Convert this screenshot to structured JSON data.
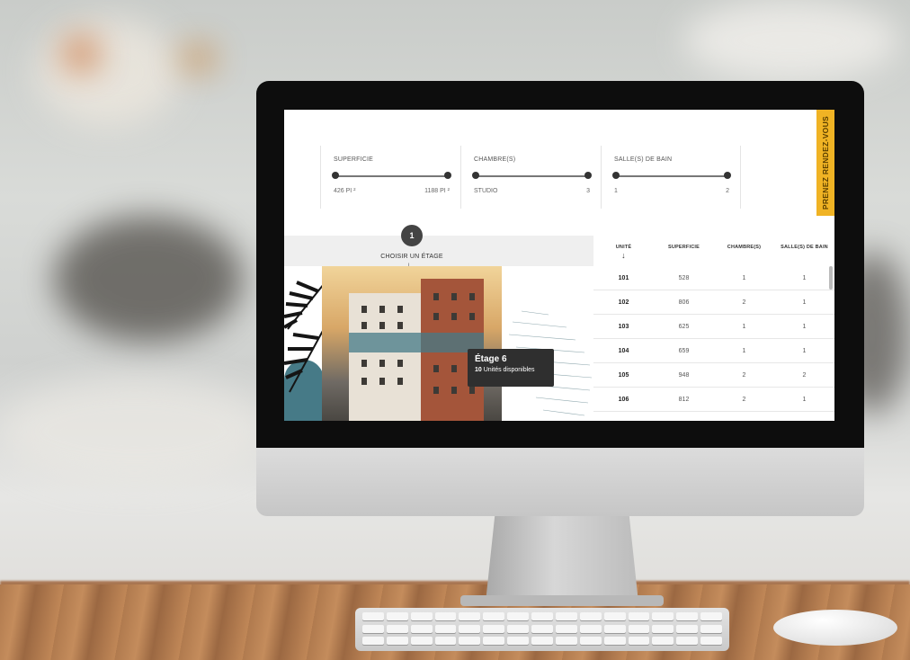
{
  "filters": [
    {
      "title": "SUPERFICIE",
      "min": "426 PI ²",
      "max": "1188 PI ²"
    },
    {
      "title": "CHAMBRE(S)",
      "min": "STUDIO",
      "max": "3"
    },
    {
      "title": "SALLE(S) DE BAIN",
      "min": "1",
      "max": "2"
    }
  ],
  "cta": {
    "label": "PRENEZ RENDEZ-VOUS"
  },
  "floor_picker": {
    "step": "1",
    "label": "CHOISIR UN ÉTAGE",
    "arrow": "↓"
  },
  "tooltip": {
    "title": "Étage 6",
    "count": "10",
    "count_label": "Unités disponibles"
  },
  "table": {
    "headers": {
      "unit": "UNITÉ",
      "area": "SUPERFICIE",
      "bedrooms": "CHAMBRE(S)",
      "bathrooms": "SALLE(S) DE BAIN",
      "sort_arrow": "↓"
    },
    "rows": [
      {
        "unit": "101",
        "area": "528",
        "bedrooms": "1",
        "bathrooms": "1"
      },
      {
        "unit": "102",
        "area": "806",
        "bedrooms": "2",
        "bathrooms": "1"
      },
      {
        "unit": "103",
        "area": "625",
        "bedrooms": "1",
        "bathrooms": "1"
      },
      {
        "unit": "104",
        "area": "659",
        "bedrooms": "1",
        "bathrooms": "1"
      },
      {
        "unit": "105",
        "area": "948",
        "bedrooms": "2",
        "bathrooms": "2"
      },
      {
        "unit": "106",
        "area": "812",
        "bedrooms": "2",
        "bathrooms": "1"
      }
    ]
  },
  "colors": {
    "cta": "#f0b324",
    "teal": "#467a87",
    "tooltip": "#2f2f2f"
  }
}
